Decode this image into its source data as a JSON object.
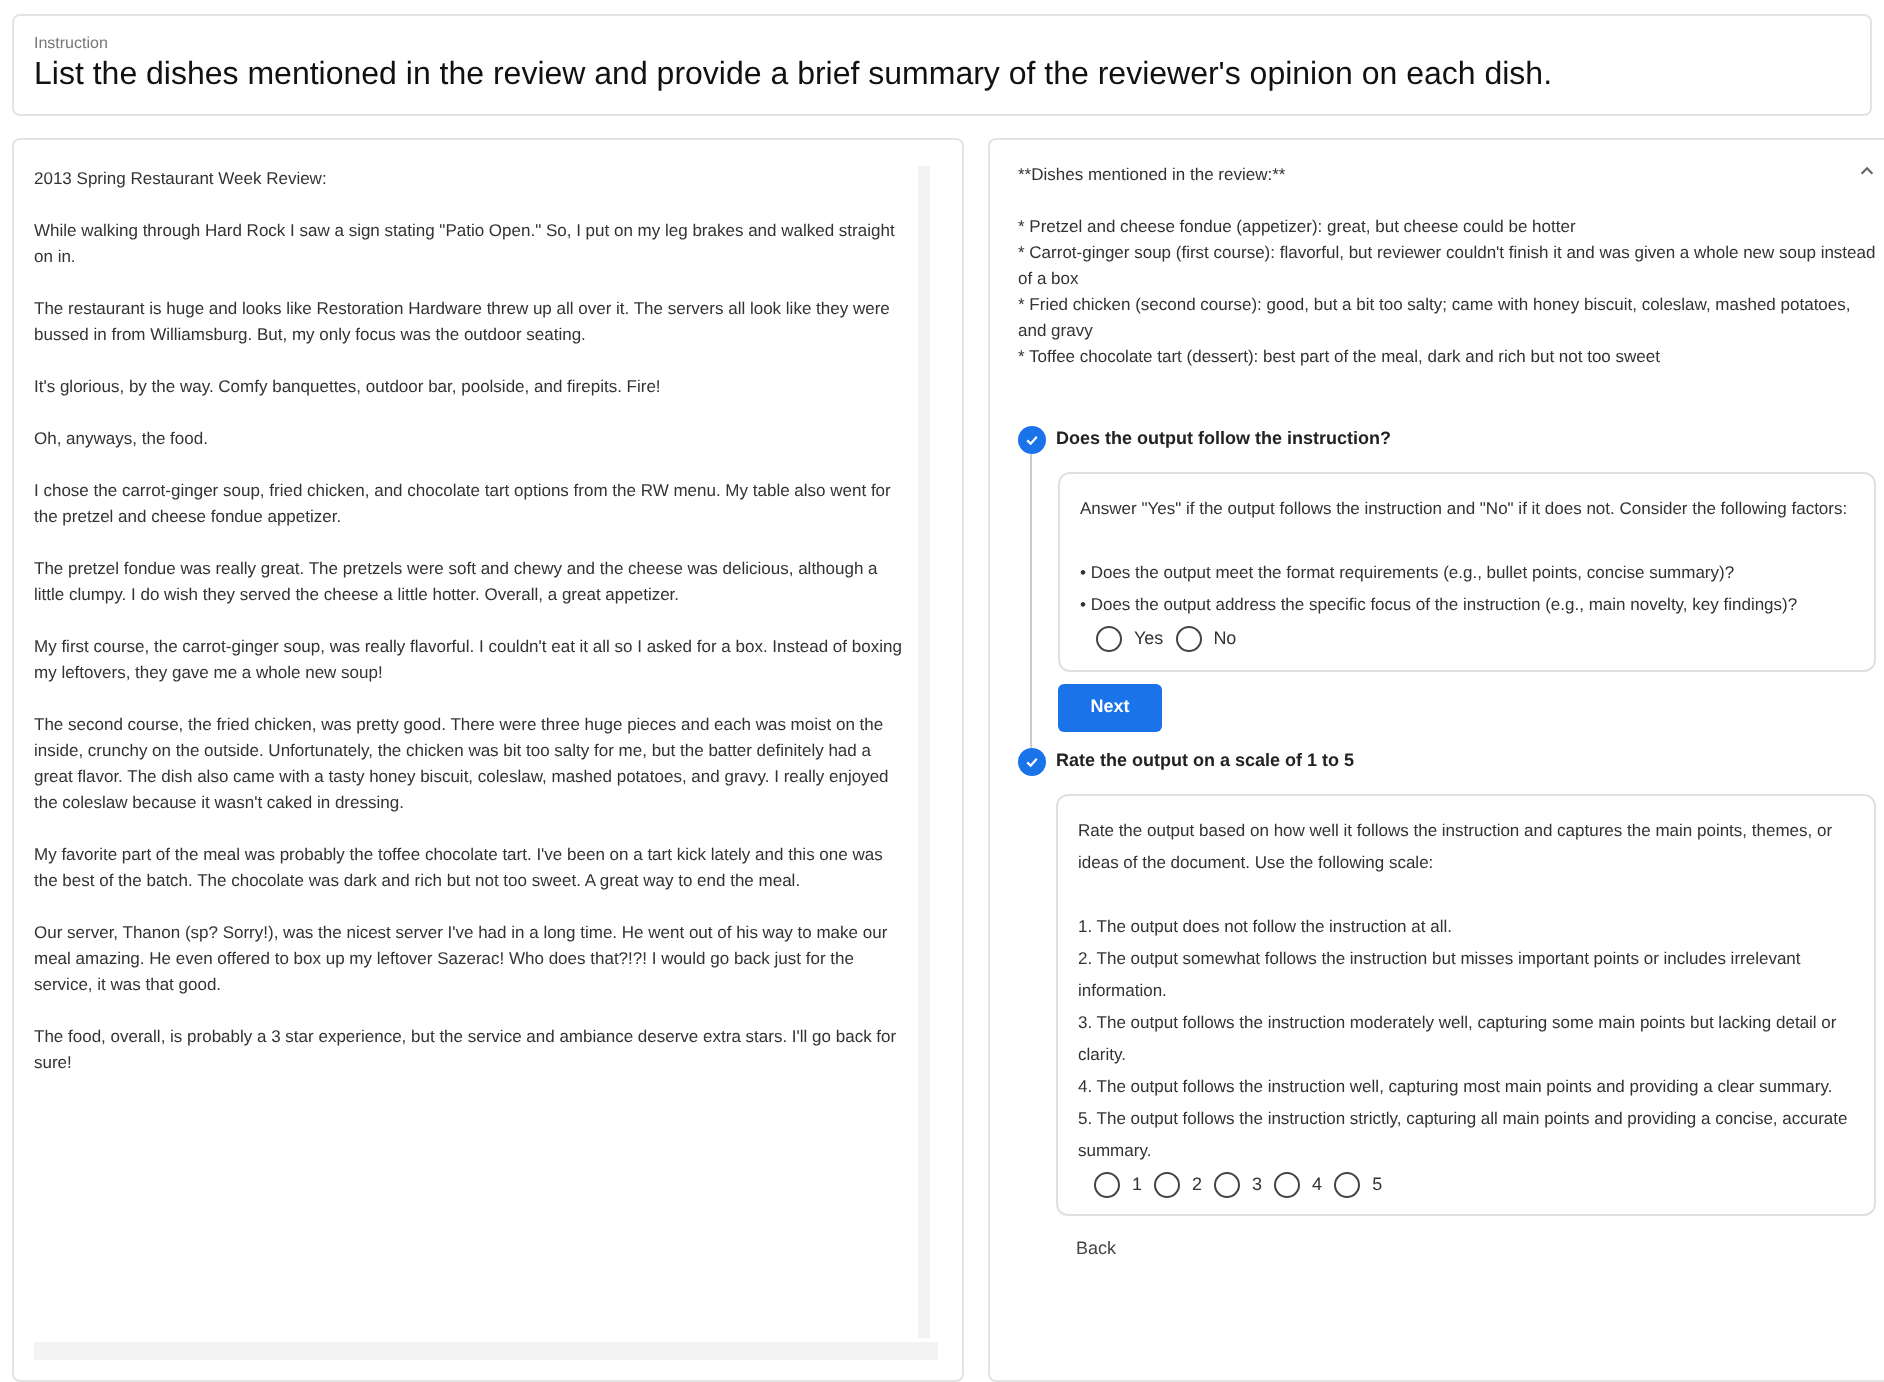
{
  "instruction": {
    "label": "Instruction",
    "text": "List the dishes mentioned in the review and provide a brief summary of the reviewer's opinion on each dish."
  },
  "document": {
    "paragraphs": [
      "2013 Spring Restaurant Week Review:",
      "While walking through Hard Rock I saw a sign stating \"Patio Open.\" So, I put on my leg brakes and walked straight on in.",
      "The restaurant is huge and looks like Restoration Hardware threw up all over it. The servers all look like they were bussed in from Williamsburg. But, my only focus was the outdoor seating.",
      "It's glorious, by the way. Comfy banquettes, outdoor bar, poolside, and firepits. Fire!",
      "Oh, anyways, the food.",
      "I chose the carrot-ginger soup, fried chicken, and chocolate tart options from the RW menu. My table also went for the pretzel and cheese fondue appetizer.",
      "The pretzel fondue was really great. The pretzels were soft and chewy and the cheese was delicious, although a little clumpy. I do wish they served the cheese a little hotter. Overall, a great appetizer.",
      "My first course, the carrot-ginger soup, was really flavorful. I couldn't eat it all so I asked for a box. Instead of boxing my leftovers, they gave me a whole new soup!",
      "The second course, the fried chicken, was pretty good. There were three huge pieces and each was moist on the inside, crunchy on the outside. Unfortunately, the chicken was bit too salty for me, but the batter definitely had a great flavor. The dish also came with a tasty honey biscuit, coleslaw, mashed potatoes, and gravy. I really enjoyed the coleslaw because it wasn't caked in dressing.",
      "My favorite part of the meal was probably the toffee chocolate tart. I've been on a tart kick lately and this one was the best of the batch. The chocolate was dark and rich but not too sweet. A great way to end the meal.",
      "Our server, Thanon (sp? Sorry!), was the nicest server I've had in a long time. He went out of his way to make our meal amazing. He even offered to box up my leftover Sazerac! Who does that?!?! I would go back just for the service, it was that good.",
      "The food, overall, is probably a 3 star experience, but the service and ambiance deserve extra stars. I'll go back for sure!"
    ]
  },
  "output": {
    "expanded": true,
    "heading": "**Dishes mentioned in the review:**",
    "lines": [
      "* Pretzel and cheese fondue (appetizer): great, but cheese could be hotter",
      "* Carrot-ginger soup (first course): flavorful, but reviewer couldn't finish it and was given a whole new soup instead of a box",
      "* Fried chicken (second course): good, but a bit too salty; came with honey biscuit, coleslaw, mashed potatoes, and gravy",
      "* Toffee chocolate tart (dessert): best part of the meal, dark and rich but not too sweet"
    ]
  },
  "steps": [
    {
      "title": "Does the output follow the instruction?",
      "completed": true,
      "intro": "Answer \"Yes\" if the output follows the instruction and \"No\" if it does not. Consider the following factors:",
      "items": [
        "• Does the output meet the format requirements (e.g., bullet points, concise summary)?",
        "• Does the output address the specific focus of the instruction (e.g., main novelty, key findings)?"
      ],
      "options": [
        {
          "label": "Yes",
          "selected": false
        },
        {
          "label": "No",
          "selected": false
        }
      ],
      "button": "Next"
    },
    {
      "title": "Rate the output on a scale of 1 to 5",
      "completed": true,
      "intro": "Rate the output based on how well it follows the instruction and captures the main points, themes, or ideas of the document. Use the following scale:",
      "items": [
        "1. The output does not follow the instruction at all.",
        "2. The output somewhat follows the instruction but misses important points or includes irrelevant information.",
        "3. The output follows the instruction moderately well, capturing some main points but lacking detail or clarity.",
        "4. The output follows the instruction well, capturing most main points and providing a clear summary.",
        "5. The output follows the instruction strictly, capturing all main points and providing a concise, accurate summary."
      ],
      "options": [
        {
          "label": "1",
          "selected": false
        },
        {
          "label": "2",
          "selected": false
        },
        {
          "label": "3",
          "selected": false
        },
        {
          "label": "4",
          "selected": false
        },
        {
          "label": "5",
          "selected": false
        }
      ]
    }
  ],
  "back": "Back"
}
